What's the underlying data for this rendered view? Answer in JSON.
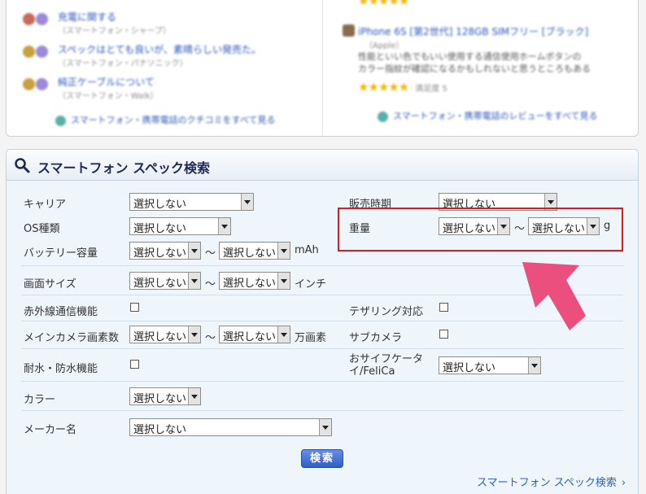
{
  "top": {
    "qa_items": [
      {
        "title": "充電に関する",
        "sub": "（スマートフォン・シャープ）"
      },
      {
        "title": "スペックはとても良いが、素晴らしい発売た。",
        "sub": "（スマートフォン・パナソニック）"
      },
      {
        "title": "純正ケーブルについて",
        "sub": "（スマートフォン・Walk）"
      }
    ],
    "qa_more": "スマートフォン・携帯電話のクチコミをすべて見る",
    "review": {
      "title": "iPhone 6S [第2世代] 128GB SIMフリー [ブラック]",
      "meta": "（Apple）",
      "text_line1": "性能といい色でもいい使用する通信使用ホームボタンの",
      "text_line2": "カラー指紋が確認になるかもしれないと思うところもある",
      "stars": "★★★★★",
      "stars_meta": "満足度 5"
    },
    "review_more": "スマートフォン・携帯電話のレビューをすべて見る"
  },
  "panel": {
    "title": "スマートフォン スペック検索"
  },
  "form": {
    "carrier": {
      "label": "キャリア",
      "value": "選択しない"
    },
    "release": {
      "label": "販売時期",
      "value": "選択しない"
    },
    "os": {
      "label": "OS種類",
      "value": "選択しない"
    },
    "weight": {
      "label": "重量",
      "min": "選択しない",
      "tilde": "～",
      "max": "選択しない",
      "unit": "g"
    },
    "battery": {
      "label": "バッテリー容量",
      "min": "選択しない",
      "tilde": "～",
      "max": "選択しない",
      "unit": "mAh"
    },
    "screen": {
      "label": "画面サイズ",
      "min": "選択しない",
      "tilde": "～",
      "max": "選択しない",
      "unit": "インチ"
    },
    "infrared": {
      "label": "赤外線通信機能"
    },
    "tethering": {
      "label": "テザリング対応"
    },
    "main_camera": {
      "label": "メインカメラ画素数",
      "min": "選択しない",
      "tilde": "～",
      "max": "選択しない",
      "unit": "万画素"
    },
    "sub_camera": {
      "label": "サブカメラ"
    },
    "waterproof": {
      "label": "耐水・防水機能"
    },
    "felica": {
      "label_line1": "おサイフケータ",
      "label_line2": "イ/FeliCa",
      "value": "選択しない"
    },
    "color": {
      "label": "カラー",
      "value": "選択しない"
    },
    "maker": {
      "label": "メーカー名",
      "value": "選択しない"
    }
  },
  "search_button": "検索",
  "footer_link": "スマートフォン スペック検索",
  "footer_chevron": "›",
  "colors": {
    "accent": "#2a55b8",
    "highlight": "#e01818",
    "arrow": "#ea4f7e"
  }
}
